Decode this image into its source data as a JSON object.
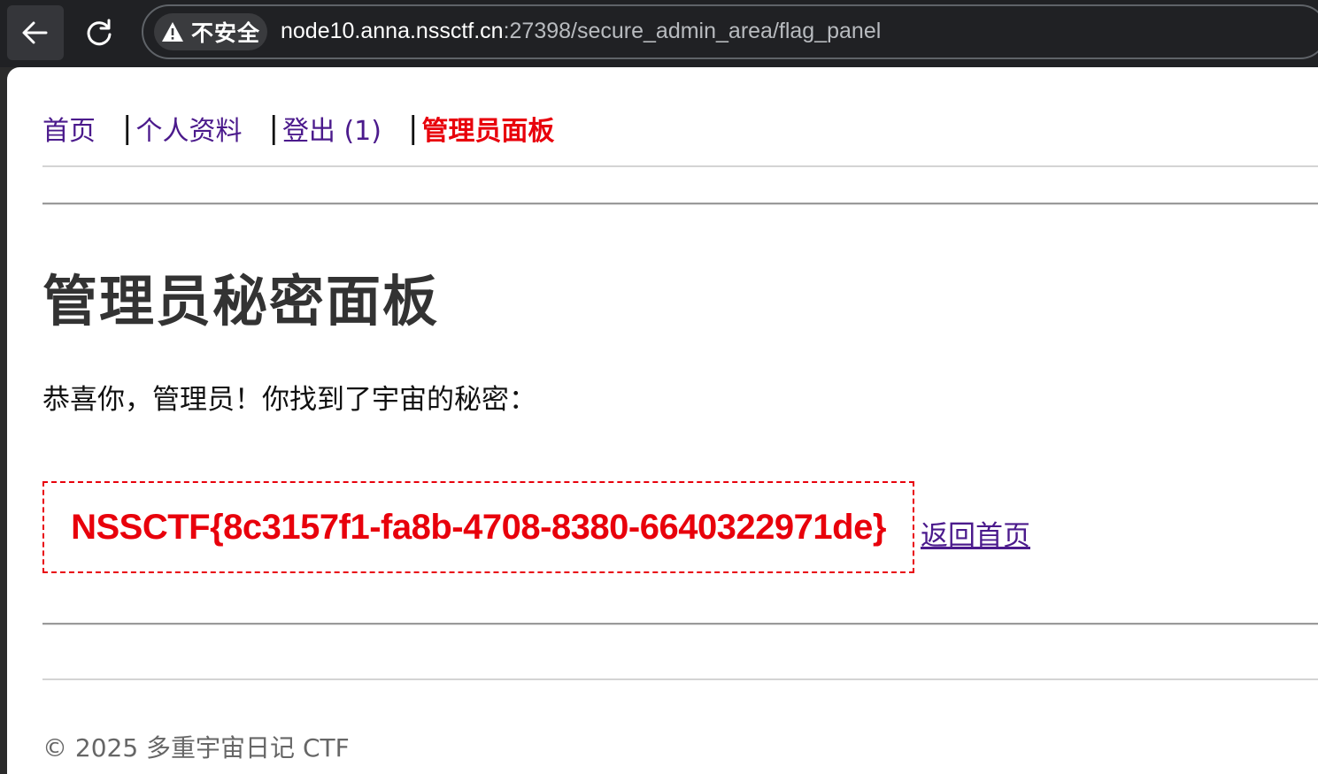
{
  "browser": {
    "security_label": "不安全",
    "url_host": "node10.anna.nssctf.cn",
    "url_path": ":27398/secure_admin_area/flag_panel"
  },
  "nav": {
    "items": [
      {
        "label": "首页"
      },
      {
        "label": "个人资料"
      },
      {
        "label": "登出 (1)"
      },
      {
        "label": "管理员面板"
      }
    ],
    "separator": "|",
    "active_color": "#e8000b",
    "link_color": "#4b1a8c"
  },
  "main": {
    "title": "管理员秘密面板",
    "message": "恭喜你，管理员！你找到了宇宙的秘密：",
    "flag": "NSSCTF{8c3157f1-fa8b-4708-8380-6640322971de}",
    "back_link": "返回首页"
  },
  "footer": {
    "text": "© 2025 多重宇宙日记 CTF"
  }
}
